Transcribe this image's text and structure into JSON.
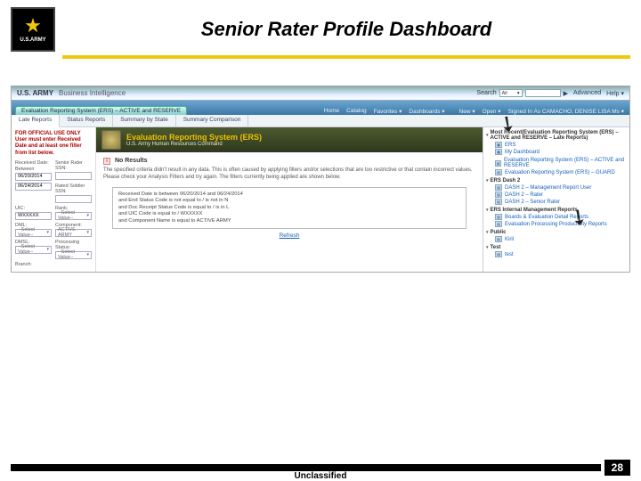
{
  "slide": {
    "title": "Senior Rater Profile Dashboard",
    "classification": "Unclassified",
    "page": "28"
  },
  "army_logo": {
    "text": "U.S.ARMY"
  },
  "bi": {
    "brand": "U.S. ARMY",
    "sub": "Business Intelligence",
    "search_label": "Search",
    "search_all": "All",
    "search_go": "▶",
    "advanced": "Advanced",
    "help": "Help ▾"
  },
  "toprow": {
    "tab": "Evaluation Reporting System (ERS) – ACTIVE and RESERVE",
    "menus": [
      "Home",
      "Catalog",
      "Favorites ▾"
    ],
    "dash": "Dashboards ▾",
    "right": [
      "New ▾",
      "Open ▾",
      "Signed In As  CAMACHO, DENISE  LISA Ms ▾"
    ]
  },
  "subtabs": [
    "Late Reports",
    "Status Reports",
    "Summary by State",
    "Summary Comparison"
  ],
  "filters": {
    "hint": "FOR OFFICIAL USE ONLY\nUser must enter Received Date and at least one filter from list below.",
    "recv_lbl": "Received Date:",
    "between": "Between",
    "d1": "06/20/2014",
    "d2": "06/24/2014",
    "sr_ssn_lbl": "Senior Rater SSN:",
    "rated_ssn_lbl": "Rated Soldier SSN:",
    "uic_lbl": "UIC:",
    "uic_val": "WXXXXX",
    "rank_lbl": "Rank:",
    "rank_ph": "--Select Value--",
    "dml_lbl": "DML:",
    "dml_ph": "--Select Value--",
    "comp_lbl": "Component:",
    "comp_val": "ACTIVE ARMY",
    "dmsl_lbl": "DMSL:",
    "dmsl_ph": "--Select Value--",
    "proc_lbl": "Processing Status:",
    "proc_ph": "--Select Value--",
    "branch_lbl": "Branch:"
  },
  "ers": {
    "title": "Evaluation Reporting System (ERS)",
    "sub": "U.S. Army Human Resources Command"
  },
  "nores": {
    "title": "No Results",
    "msg": "The specified criteria didn't result in any data. This is often caused by applying filters and/or selections that are too restrictive or that contain incorrect values. Please check your Analysis Filters and try again. The filters currently being applied are shown below.",
    "f1": "Received Date is between 06/20/2014 and 06/24/2014",
    "f2": "and End Status Code is not equal to / is not in N",
    "f3": "and Doc Receipt Status Code is equal to / is in L",
    "f4": "and UIC Code is equal to / WXXXXX",
    "f5": "and Component Name is equal to ACTIVE ARMY",
    "refresh": "Refresh"
  },
  "right": {
    "sec1": "Most Recent(Evaluation Reporting System (ERS) – ACTIVE and RESERVE – Late Reports)",
    "items1": [
      "ERS",
      "My Dashboard"
    ],
    "sec2_items": [
      "Evaluation Reporting System (ERS) – ACTIVE and RESERVE",
      "Evaluation Reporting System (ERS) – GUARD"
    ],
    "sec3": "ERS Dash 2",
    "items3": [
      "DASH 2 – Management Report User",
      "DASH 2 – Rater",
      "DASH 2 – Senior Rater"
    ],
    "sec4": "ERS Internal Management Reports",
    "items4": [
      "Boards & Evaluation Detail Reports",
      "Evaluation Processing Productivity Reports"
    ],
    "sec5": "Public",
    "items5": [
      "Kiril"
    ],
    "sec6": "Test",
    "items6": [
      "test"
    ]
  }
}
